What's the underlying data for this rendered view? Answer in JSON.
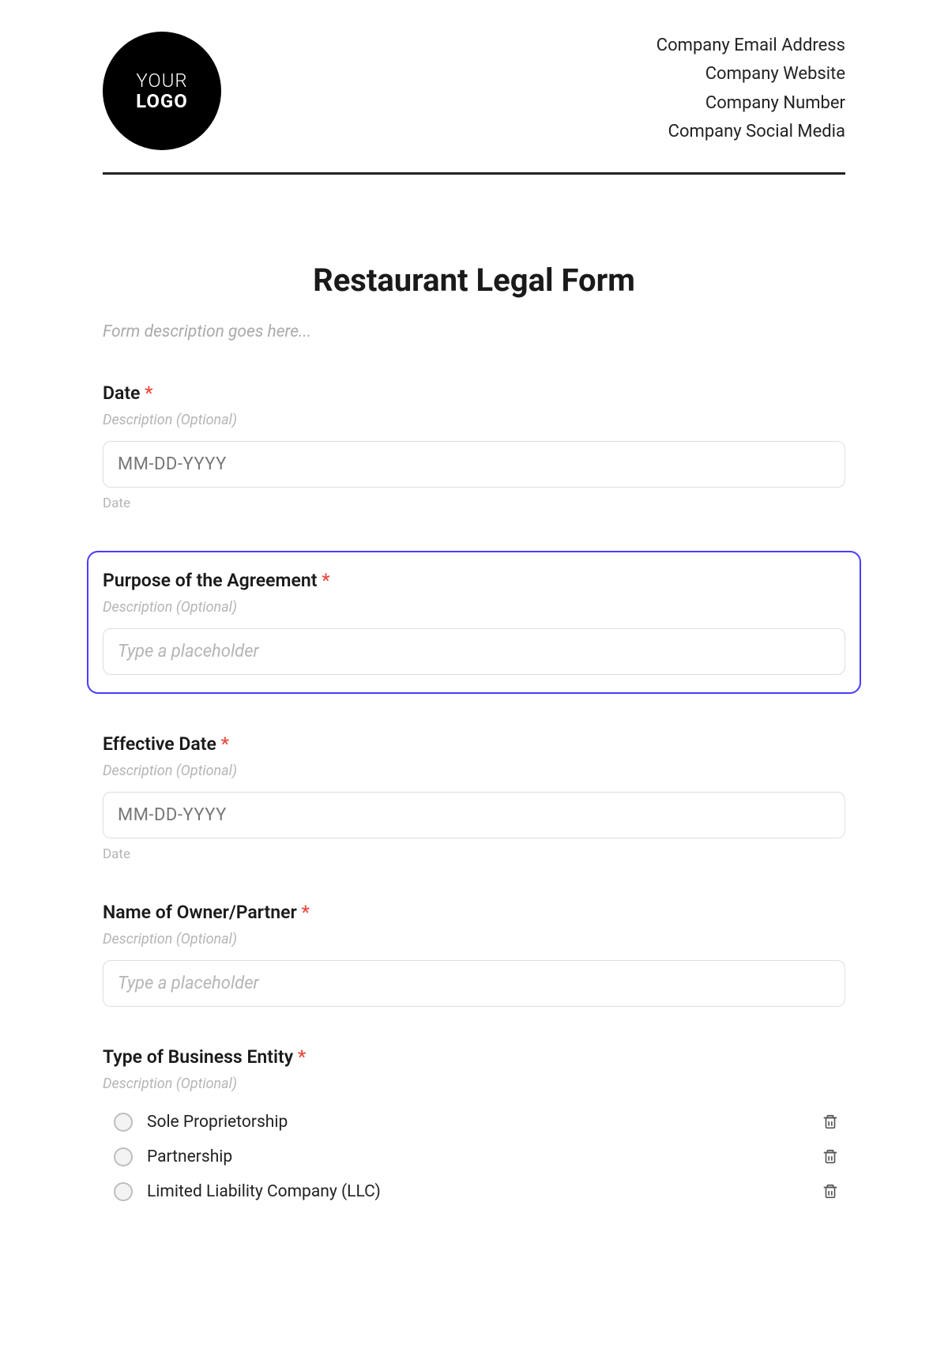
{
  "header": {
    "logo_line1": "YOUR",
    "logo_line2": "LOGO",
    "company_lines": [
      "Company Email Address",
      "Company Website",
      "Company Number",
      "Company Social Media"
    ]
  },
  "form": {
    "title": "Restaurant Legal Form",
    "description_placeholder": "Form description goes here...",
    "fields": {
      "date": {
        "label": "Date",
        "required_mark": "*",
        "description_placeholder": "Description (Optional)",
        "input_placeholder": "MM-DD-YYYY",
        "below": "Date"
      },
      "purpose": {
        "label": "Purpose of the Agreement",
        "required_mark": "*",
        "description_placeholder": "Description (Optional)",
        "input_placeholder": "Type a placeholder"
      },
      "effective_date": {
        "label": "Effective Date",
        "required_mark": "*",
        "description_placeholder": "Description (Optional)",
        "input_placeholder": "MM-DD-YYYY",
        "below": "Date"
      },
      "owner_name": {
        "label": "Name of Owner/Partner",
        "required_mark": "*",
        "description_placeholder": "Description (Optional)",
        "input_placeholder": "Type a placeholder"
      },
      "entity_type": {
        "label": "Type of Business Entity",
        "required_mark": "*",
        "description_placeholder": "Description (Optional)",
        "options": [
          "Sole Proprietorship",
          "Partnership",
          "Limited Liability Company (LLC)"
        ]
      }
    }
  }
}
